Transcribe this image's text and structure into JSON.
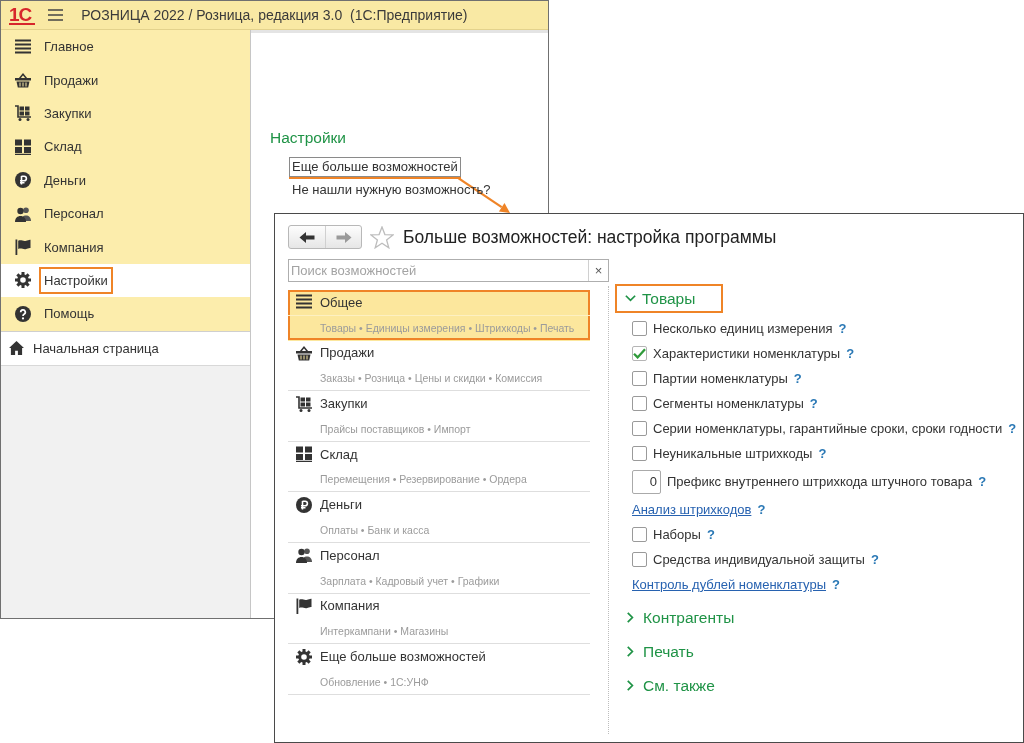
{
  "main_window": {
    "logo": "1С",
    "title": "РОЗНИЦА 2022 / Розница, редакция 3.0  (1С:Предприятие)",
    "sections": [
      {
        "label": "Главное",
        "selected": false,
        "highlighted": false
      },
      {
        "label": "Продажи",
        "selected": false,
        "highlighted": false
      },
      {
        "label": "Закупки",
        "selected": false,
        "highlighted": false
      },
      {
        "label": "Склад",
        "selected": false,
        "highlighted": false
      },
      {
        "label": "Деньги",
        "selected": false,
        "highlighted": false
      },
      {
        "label": "Персонал",
        "selected": false,
        "highlighted": false
      },
      {
        "label": "Компания",
        "selected": false,
        "highlighted": false
      },
      {
        "label": "Настройки",
        "selected": true,
        "highlighted": true
      },
      {
        "label": "Помощь",
        "selected": false,
        "highlighted": false
      }
    ],
    "start_page": {
      "label": "Начальная страница"
    },
    "content": {
      "heading": "Настройки",
      "links": [
        {
          "label": "Еще больше возможностей",
          "focused": true,
          "highlighted": true
        },
        {
          "label": "Не нашли нужную возможность?",
          "focused": false,
          "highlighted": false
        }
      ]
    }
  },
  "dialog": {
    "title": "Больше возможностей: настройка программы",
    "search": {
      "placeholder": "Поиск возможностей",
      "clear": "×"
    },
    "sections": [
      {
        "name": "Общее",
        "details": "Товары • Единицы измерения • Штрихкоды • Печать",
        "selected": true,
        "highlighted": true
      },
      {
        "name": "Продажи",
        "details": "Заказы • Розница • Цены и скидки • Комиссия",
        "selected": false,
        "highlighted": false
      },
      {
        "name": "Закупки",
        "details": "Прайсы поставщиков • Импорт",
        "selected": false,
        "highlighted": false
      },
      {
        "name": "Склад",
        "details": "Перемещения • Резервирование • Ордера",
        "selected": false,
        "highlighted": false
      },
      {
        "name": "Деньги",
        "details": "Оплаты • Банк и касса",
        "selected": false,
        "highlighted": false
      },
      {
        "name": "Персонал",
        "details": "Зарплата • Кадровый учет • Графики",
        "selected": false,
        "highlighted": false
      },
      {
        "name": "Компания",
        "details": "Интеркампани • Магазины",
        "selected": false,
        "highlighted": false
      },
      {
        "name": "Еще больше возможностей",
        "details": "Обновление • 1С:УНФ",
        "selected": false,
        "highlighted": false
      }
    ],
    "groups": [
      {
        "title": "Товары",
        "expanded": true,
        "highlighted": true,
        "options": [
          {
            "kind": "checkbox",
            "label": "Несколько единиц измерения",
            "checked": false,
            "help": "?"
          },
          {
            "kind": "checkbox",
            "label": "Характеристики номенклатуры",
            "checked": true,
            "help": "?"
          },
          {
            "kind": "checkbox",
            "label": "Партии номенклатуры",
            "checked": false,
            "help": "?"
          },
          {
            "kind": "checkbox",
            "label": "Сегменты номенклатуры",
            "checked": false,
            "help": "?"
          },
          {
            "kind": "checkbox",
            "label": "Серии номенклатуры, гарантийные сроки, сроки годности",
            "checked": false,
            "help": "?"
          },
          {
            "kind": "checkbox",
            "label": "Неуникальные штрихкоды",
            "checked": false,
            "help": "?"
          },
          {
            "kind": "number",
            "value": "0",
            "label": "Префикс внутреннего штрихкода штучного товара",
            "help": "?"
          },
          {
            "kind": "link",
            "label": "Анализ штрихкодов",
            "help": "?"
          },
          {
            "kind": "checkbox",
            "label": "Наборы",
            "checked": false,
            "help": "?"
          },
          {
            "kind": "checkbox",
            "label": "Средства индивидуальной защиты",
            "checked": false,
            "help": "?"
          },
          {
            "kind": "link",
            "label": "Контроль дублей номенклатуры",
            "help": "?"
          }
        ]
      },
      {
        "title": "Контрагенты",
        "expanded": false,
        "highlighted": false
      },
      {
        "title": "Печать",
        "expanded": false,
        "highlighted": false
      },
      {
        "title": "См. также",
        "expanded": false,
        "highlighted": false
      }
    ]
  }
}
